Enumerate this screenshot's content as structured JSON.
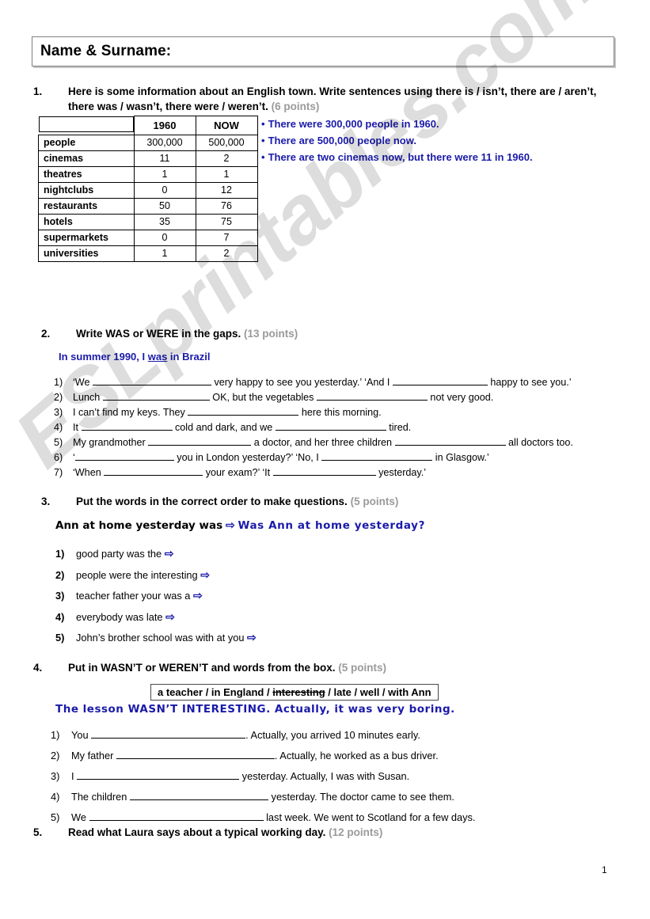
{
  "header": {
    "name_field_label": "Name & Surname:"
  },
  "watermark": {
    "text": "ESLprintables.com"
  },
  "page_number": "1",
  "exercises": [
    {
      "number": "1.",
      "instruction": "Here is some information about an English town. Write sentences using there is / isn’t, there are / aren’t, there was / wasn’t, there were / weren’t.",
      "points": "(6 points)"
    },
    {
      "number": "2.",
      "instruction": "Write WAS or WERE in the gaps.",
      "points": "(13 points)"
    },
    {
      "number": "3.",
      "instruction": "Put the words in the correct order to make questions.",
      "points": "(5 points)"
    },
    {
      "number": "4.",
      "instruction": "Put in WASN’T or WEREN’T and words from the box.",
      "points": "(5 points)"
    },
    {
      "number": "5.",
      "instruction": "Read what Laura says about a typical working day.",
      "points": "(12 points)"
    }
  ],
  "town_table": {
    "headers": [
      "",
      "1960",
      "NOW"
    ],
    "rows": [
      {
        "label": "people",
        "y1960": "300,000",
        "now": "500,000"
      },
      {
        "label": "cinemas",
        "y1960": "11",
        "now": "2"
      },
      {
        "label": "theatres",
        "y1960": "1",
        "now": "1"
      },
      {
        "label": "nightclubs",
        "y1960": "0",
        "now": "12"
      },
      {
        "label": "restaurants",
        "y1960": "50",
        "now": "76"
      },
      {
        "label": "hotels",
        "y1960": "35",
        "now": "75"
      },
      {
        "label": "supermarkets",
        "y1960": "0",
        "now": "7"
      },
      {
        "label": "universities",
        "y1960": "1",
        "now": "2"
      }
    ]
  },
  "example_sentences": [
    "There were 300,000 people in 1960.",
    "There are 500,000 people now.",
    "There are two cinemas now, but there were 11 in 1960."
  ],
  "ex2": {
    "model_prefix": "In summer 1990, I ",
    "model_underlined": "was",
    "model_suffix": " in Brazil",
    "items": [
      {
        "n": "1)",
        "parts": [
          "‘We ",
          "BLANK150",
          " very happy to see you yesterday.’ ‘And I ",
          "BLANK120",
          " happy to see you.’"
        ]
      },
      {
        "n": "2)",
        "parts": [
          "Lunch ",
          "BLANK135",
          " OK, but the vegetables ",
          "BLANK140",
          " not very good."
        ]
      },
      {
        "n": "3)",
        "parts": [
          "I can’t find my keys. They ",
          "BLANK140",
          " here this morning."
        ]
      },
      {
        "n": "4)",
        "parts": [
          "It ",
          "BLANK115",
          " cold and dark, and we ",
          "BLANK140",
          " tired."
        ]
      },
      {
        "n": "5)",
        "parts": [
          "My grandmother ",
          "BLANK130",
          " a doctor, and her three children ",
          "BLANK140",
          " all doctors too."
        ]
      },
      {
        "n": "6)",
        "parts": [
          "‘",
          "BLANK125",
          " you in London yesterday?’ ‘No, I ",
          "BLANK140",
          " in Glasgow.’"
        ]
      },
      {
        "n": "7)",
        "parts": [
          "‘When ",
          "BLANK125",
          " your exam?’ ‘It ",
          "BLANK130",
          " yesterday.’"
        ]
      }
    ]
  },
  "ex3": {
    "example_prompt": "Ann at home yesterday was",
    "arrow": "⇨",
    "example_answer": "Was Ann at home yesterday?",
    "items": [
      {
        "n": "1)",
        "text": "good party was the"
      },
      {
        "n": "2)",
        "text": "people were the interesting"
      },
      {
        "n": "3)",
        "text": "teacher father your was a"
      },
      {
        "n": "4)",
        "text": "everybody was late"
      },
      {
        "n": "5)",
        "text": "John’s brother school was with at you"
      }
    ]
  },
  "ex4": {
    "word_box": {
      "before": "a teacher / in England / ",
      "struck": "interesting",
      "after": " / late / well / with Ann"
    },
    "model": "The lesson WASN’T INTERESTING. Actually, it was very boring.",
    "items": [
      {
        "n": "1)",
        "before": "You ",
        "blank": 195,
        "after": ". Actually, you arrived 10 minutes early."
      },
      {
        "n": "2)",
        "before": "My father ",
        "blank": 200,
        "after": ". Actually, he worked as a bus driver."
      },
      {
        "n": "3)",
        "before": "I ",
        "blank": 205,
        "after": " yesterday. Actually, I was with Susan."
      },
      {
        "n": "4)",
        "before": "The children ",
        "blank": 175,
        "after": " yesterday. The doctor came to see them."
      },
      {
        "n": "5)",
        "before": "We ",
        "blank": 220,
        "after": " last week. We went to Scotland for a few days."
      }
    ]
  }
}
